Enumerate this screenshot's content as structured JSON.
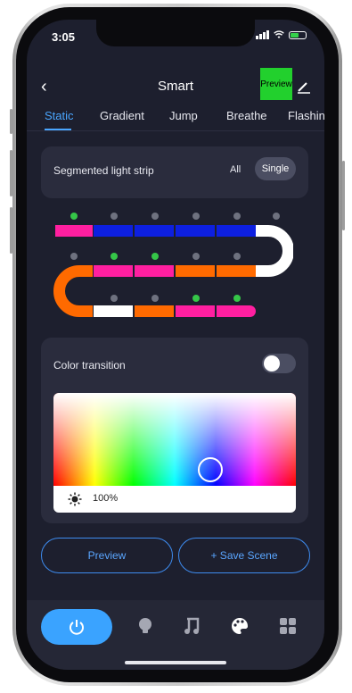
{
  "status": {
    "time": "3:05"
  },
  "header": {
    "title": "Smart",
    "preview_tag": "Preview"
  },
  "tabs": [
    {
      "label": "Static",
      "active": true
    },
    {
      "label": "Gradient",
      "active": false
    },
    {
      "label": "Jump",
      "active": false
    },
    {
      "label": "Breathe",
      "active": false
    },
    {
      "label": "Flashin",
      "active": false
    }
  ],
  "segmented": {
    "label": "Segmented light strip",
    "all_label": "All",
    "single_label": "Single",
    "selected": "Single"
  },
  "strip": {
    "row1": [
      "#ff1fa0",
      "#0d1fe0",
      "#0d1fe0",
      "#0d1fe0",
      "#0d1fe0"
    ],
    "row1_checked": [
      true,
      false,
      false,
      false,
      false,
      false
    ],
    "row2": [
      "#ff1fa0",
      "#ff1fa0",
      "#ff6a00",
      "#ff6a00"
    ],
    "row2_checked": [
      false,
      true,
      true,
      false,
      false
    ],
    "row3": [
      "#ffffff",
      "#ff6a00",
      "#ff1fa0",
      "#ff1fa0"
    ],
    "row3_checked": [
      false,
      false,
      true,
      true
    ],
    "right_curve_color": "#ffffff",
    "left_curve_color": "#ff6a00"
  },
  "color_transition": {
    "label": "Color transition",
    "enabled": false
  },
  "brightness": {
    "value": "100%"
  },
  "actions": {
    "preview_label": "Preview",
    "save_label": "+ Save Scene"
  },
  "nav": {
    "items": [
      "power-icon",
      "bulb-icon",
      "music-icon",
      "palette-icon",
      "grid-icon"
    ],
    "active": "power-icon"
  },
  "colors": {
    "accent": "#3aa3ff",
    "background": "#1d1f2e",
    "card": "#2a2c3d"
  }
}
